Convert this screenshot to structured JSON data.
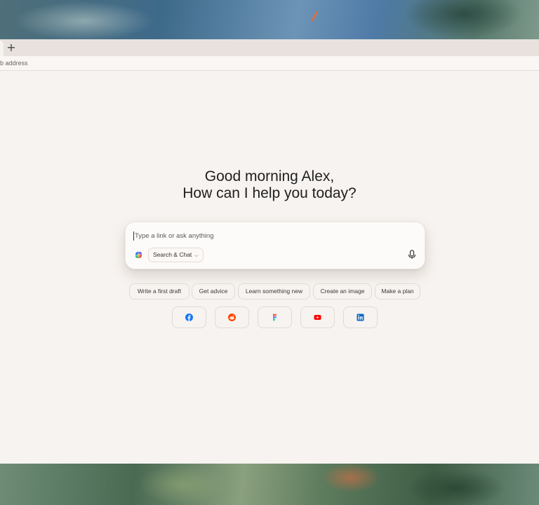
{
  "tabstrip": {
    "new_tab_glyph": "+"
  },
  "addressbar": {
    "placeholder_visible": "b address"
  },
  "greeting": {
    "line1": "Good morning Alex,",
    "line2": "How can I help you today?"
  },
  "composer": {
    "placeholder": "Type a link or ask anything",
    "mode_label": "Search & Chat",
    "mode_icon": "chevron-down-icon",
    "assistant_icon": "copilot-icon",
    "voice_icon": "microphone-icon"
  },
  "suggestions": [
    "Write a first draft",
    "Get advice",
    "Learn something new",
    "Create an image",
    "Make a plan"
  ],
  "shortcuts": [
    {
      "name": "facebook",
      "icon": "facebook-icon",
      "color": "#1877f2"
    },
    {
      "name": "reddit",
      "icon": "reddit-icon",
      "color": "#ff4500"
    },
    {
      "name": "figma",
      "icon": "figma-icon",
      "color": "#a259ff"
    },
    {
      "name": "youtube",
      "icon": "youtube-icon",
      "color": "#ff0000"
    },
    {
      "name": "linkedin",
      "icon": "linkedin-icon",
      "color": "#0a66c2"
    }
  ]
}
